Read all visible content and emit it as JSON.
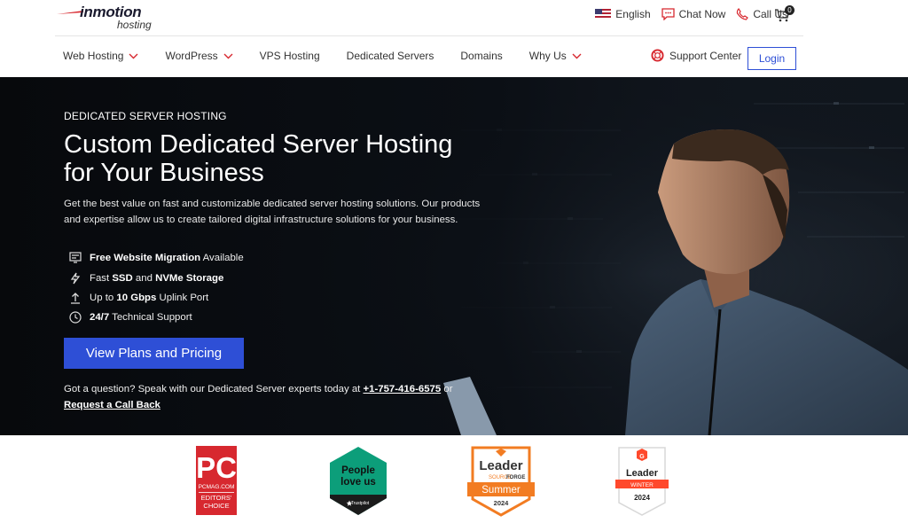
{
  "header": {
    "logo_word": "inmotion",
    "logo_sub": "hosting",
    "language": "English",
    "chat": "Chat Now",
    "call": "Call Us",
    "cart_count": "0"
  },
  "nav": {
    "items": [
      {
        "label": "Web Hosting",
        "dropdown": true
      },
      {
        "label": "WordPress",
        "dropdown": true
      },
      {
        "label": "VPS Hosting",
        "dropdown": false
      },
      {
        "label": "Dedicated Servers",
        "dropdown": false
      },
      {
        "label": "Domains",
        "dropdown": false
      },
      {
        "label": "Why Us",
        "dropdown": true
      }
    ],
    "support": "Support Center",
    "login": "Login"
  },
  "hero": {
    "eyebrow": "DEDICATED SERVER HOSTING",
    "title": "Custom Dedicated Server Hosting for Your Business",
    "description": "Get the best value on fast and customizable dedicated server hosting solutions. Our products and expertise allow us to create tailored digital infrastructure solutions for your business.",
    "features": [
      {
        "icon": "migration-icon",
        "bold1": "Free Website Migration",
        "text1": " Available",
        "bold2": "",
        "text2": ""
      },
      {
        "icon": "lightning-icon",
        "text0": "Fast ",
        "bold1": "SSD",
        "text1": " and ",
        "bold2": "NVMe Storage",
        "text2": ""
      },
      {
        "icon": "upload-arrow-icon",
        "text0": "Up to ",
        "bold1": "10 Gbps",
        "text1": " Uplink Port",
        "bold2": "",
        "text2": ""
      },
      {
        "icon": "clock-icon",
        "text0": "",
        "bold1": "24/7",
        "text1": " Technical Support",
        "bold2": "",
        "text2": ""
      }
    ],
    "cta": "View Plans and Pricing",
    "question_text": "Got a question? Speak with our Dedicated Server experts today at ",
    "phone": "+1-757-416-6575",
    "question_or": " or",
    "callback": "Request a Call Back"
  },
  "badges": {
    "pc": {
      "big": "PC",
      "site": "PCMAG.COM",
      "line1": "EDITORS'",
      "line2": "CHOICE"
    },
    "trustpilot": {
      "line1": "People",
      "line2": "love us",
      "brand": "Trustpilot"
    },
    "sourceforge": {
      "title": "Leader",
      "brand_a": "SOURCE",
      "brand_b": "FORGE",
      "season": "Summer",
      "year": "2024"
    },
    "g2": {
      "logo": "G",
      "title": "Leader",
      "season": "WINTER",
      "year": "2024"
    }
  },
  "colors": {
    "accent": "#2e4fd6",
    "brand_red": "#d7282f",
    "hero_bg": "#0a0d12"
  }
}
